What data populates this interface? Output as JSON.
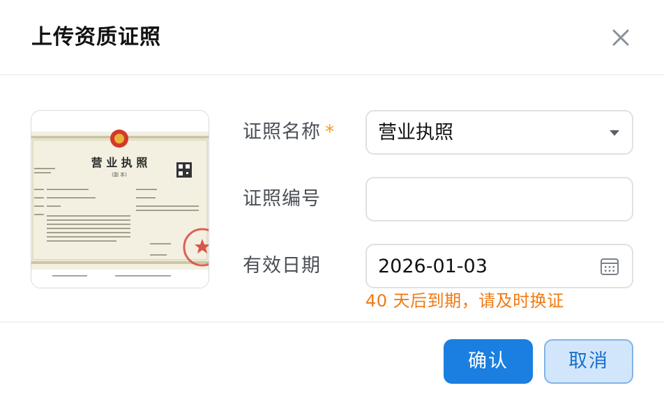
{
  "dialog": {
    "title": "上传资质证照",
    "close_icon": "close-icon"
  },
  "thumbnail": {
    "heading": "营 业 执 照",
    "sub_heading": "(副 本)"
  },
  "form": {
    "license_name": {
      "label": "证照名称",
      "required_mark": "*",
      "value": "营业执照",
      "icon": "chevron-down-icon"
    },
    "license_number": {
      "label": "证照编号",
      "value": ""
    },
    "valid_date": {
      "label": "有效日期",
      "value": "2026-01-03",
      "icon": "calendar-icon",
      "hint": "40 天后到期，请及时换证"
    }
  },
  "footer": {
    "confirm_label": "确认",
    "cancel_label": "取消"
  },
  "colors": {
    "primary": "#1a7fe0",
    "warning": "#f07a14",
    "required": "#f0a020"
  }
}
